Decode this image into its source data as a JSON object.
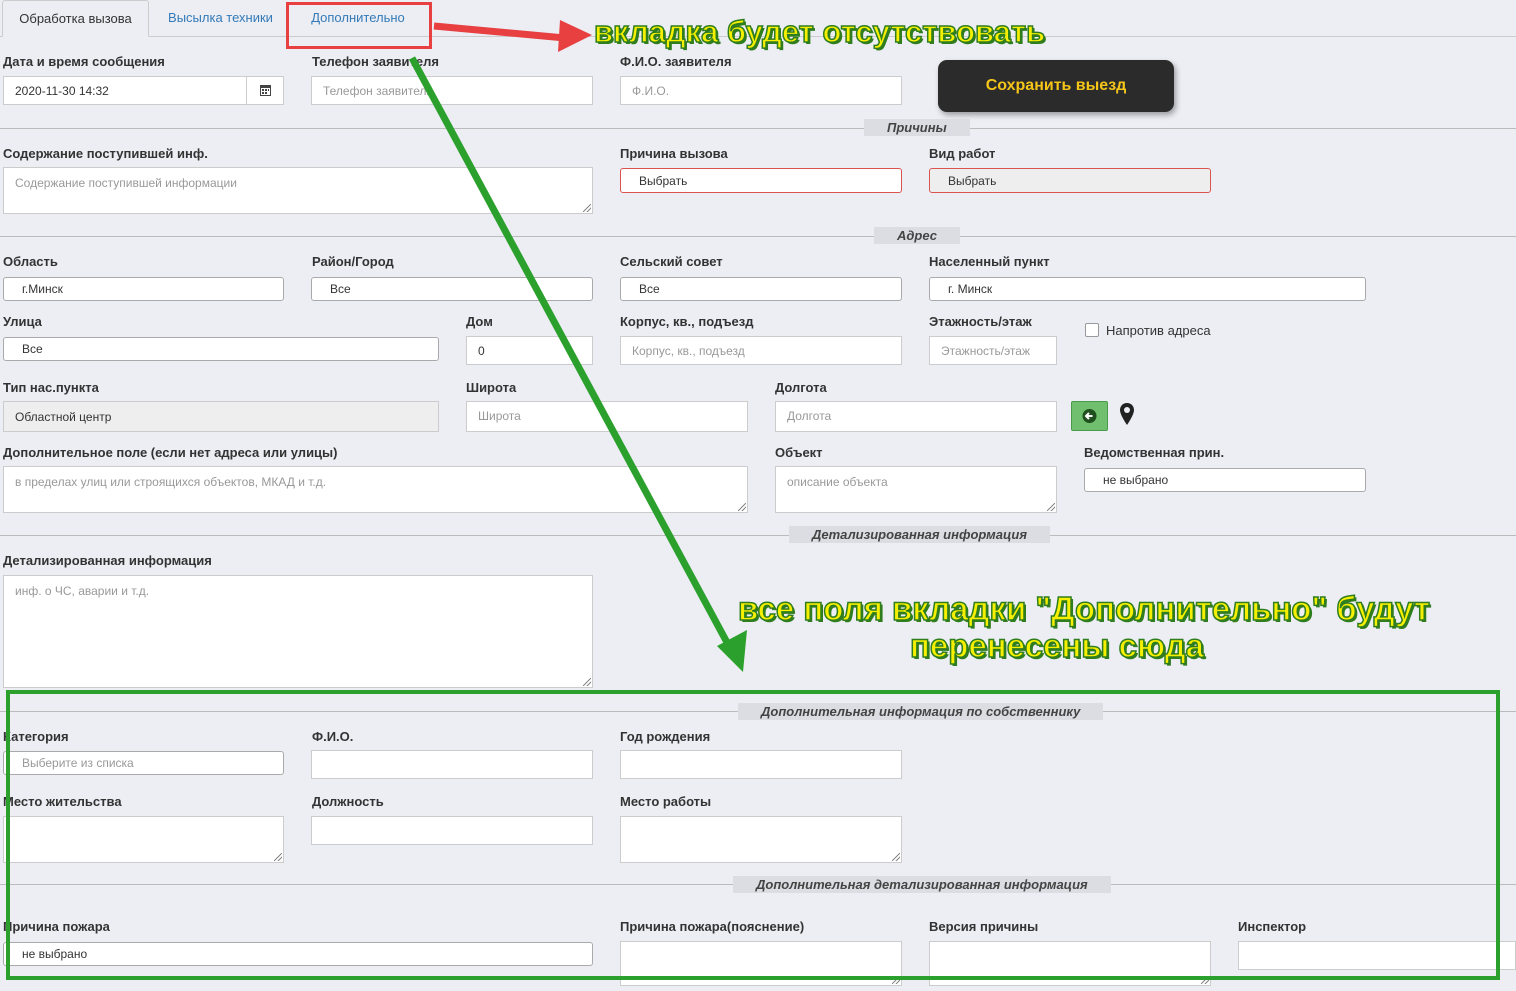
{
  "tabs": [
    {
      "label": "Обработка вызова"
    },
    {
      "label": "Высылка техники"
    },
    {
      "label": "Дополнительно"
    }
  ],
  "fields": {
    "date_label": "Дата и время сообщения",
    "date_value": "2020-11-30 14:32",
    "phone_label": "Телефон заявителя",
    "phone_placeholder": "Телефон заявителя",
    "fio_label": "Ф.И.О. заявителя",
    "fio_placeholder": "Ф.И.О.",
    "save_button": "Сохранить выезд",
    "content_label": "Содержание поступившей инф.",
    "content_placeholder": "Содержание поступившей информации",
    "reason_label": "Причина вызова",
    "reason_value": "Выбрать",
    "work_label": "Вид работ",
    "work_value": "Выбрать",
    "region_label": "Область",
    "region_value": "г.Минск",
    "district_label": "Район/Город",
    "district_value": "Все",
    "council_label": "Сельский совет",
    "council_value": "Все",
    "locality_label": "Населенный пункт",
    "locality_value": "г. Минск",
    "street_label": "Улица",
    "street_value": "Все",
    "house_label": "Дом",
    "house_value": "0",
    "building_label": "Корпус, кв., подъезд",
    "building_placeholder": "Корпус, кв., подъезд",
    "floor_label": "Этажность/этаж",
    "floor_placeholder": "Этажность/этаж",
    "opposite_label": "Напротив адреса",
    "type_label": "Тип нас.пункта",
    "type_value": "Областной центр",
    "lat_label": "Широта",
    "lat_placeholder": "Широта",
    "lon_label": "Долгота",
    "lon_placeholder": "Долгота",
    "extra_label": "Дополнительное поле (если нет адреса или улицы)",
    "extra_placeholder": "в пределах улиц или строящихся объектов, МКАД и т.д.",
    "object_label": "Объект",
    "object_placeholder": "описание объекта",
    "dept_label": "Ведомственная прин.",
    "dept_value": "не выбрано",
    "detail_label": "Детализированная информация",
    "detail_placeholder": "инф. о ЧС, аварии и т.д.",
    "category_label": "Категория",
    "category_placeholder": "Выберите из списка",
    "owner_fio_label": "Ф.И.О.",
    "birth_label": "Год рождения",
    "residence_label": "Место жительства",
    "position_label": "Должность",
    "workplace_label": "Место работы",
    "fire_reason_label": "Причина пожара",
    "fire_reason_value": "не выбрано",
    "fire_expl_label": "Причина пожара(пояснение)",
    "version_label": "Версия причины",
    "inspector_label": "Инспектор"
  },
  "sections": {
    "reasons": "Причины",
    "address": "Адрес",
    "detailed": "Детализированная информация",
    "owner": "Дополнительная информация по собственнику",
    "extra_detailed": "Дополнительная детализированная информация"
  },
  "annotations": {
    "tab_note": "вкладка будет отсутствовать",
    "fields_note_1": "все поля вкладки \"Дополнительно\" будут",
    "fields_note_2": "перенесены сюда"
  },
  "colors": {
    "link": "#337ab7",
    "required_border": "#d9534f",
    "annotation_red": "#e84040",
    "annotation_green": "#2ca02c",
    "annotation_text": "#f6f000",
    "save_button_bg": "#2b2b2b",
    "save_button_text": "#f5c518",
    "geo_button": "#5cb85c"
  }
}
